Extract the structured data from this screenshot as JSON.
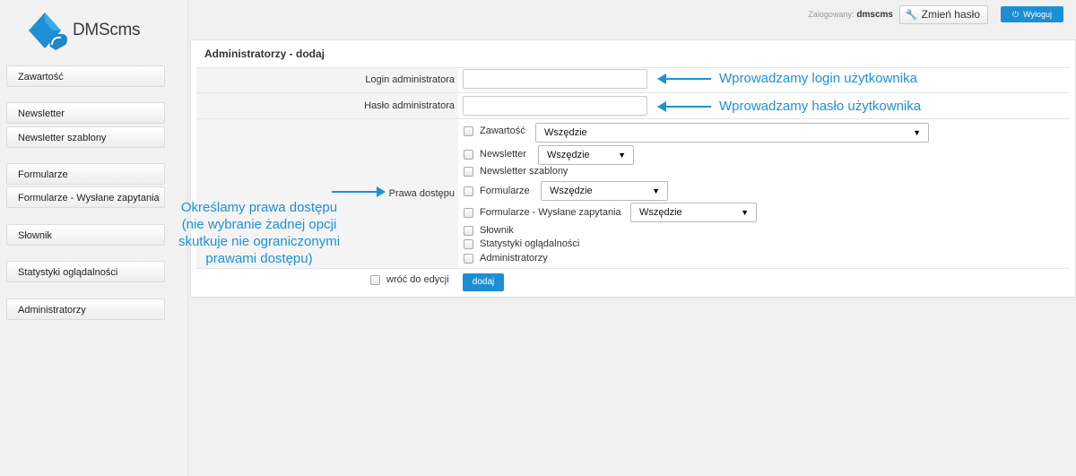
{
  "brand": {
    "name": "DMScms",
    "accent": "#1e8ed3",
    "note_color": "#1e90d6"
  },
  "sidebar": {
    "items": [
      {
        "label": "Zawartość"
      },
      {
        "label": "Newsletter"
      },
      {
        "label": "Newsletter szablony"
      },
      {
        "label": "Formularze"
      },
      {
        "label": "Formularze - Wysłane zapytania"
      },
      {
        "label": "Słownik"
      },
      {
        "label": "Statystyki oglądalności"
      },
      {
        "label": "Administratorzy"
      }
    ]
  },
  "header": {
    "logged_label": "Zalogowany:",
    "username": "dmscms",
    "change_password_label": "Zmień hasło",
    "change_password_icon": "wrench-icon",
    "logout_label": "Wyloguj",
    "logout_icon": "power-icon"
  },
  "form": {
    "title": "Administratorzy - dodaj",
    "login_label": "Login administratora",
    "login_value": "",
    "password_label": "Hasło administratora",
    "password_value": "",
    "rights_label": "Prawa dostępu",
    "permissions": [
      {
        "label": "Zawartość",
        "select": "Wszędzie"
      },
      {
        "label": "Newsletter",
        "select": "Wszędzie"
      },
      {
        "label": "Newsletter szablony"
      },
      {
        "label": "Formularze",
        "select": "Wszędzie"
      },
      {
        "label": "Formularze - Wysłane zapytania",
        "select": "Wszędzie"
      },
      {
        "label": "Słownik"
      },
      {
        "label": "Statystyki oglądalności"
      },
      {
        "label": "Administratorzy"
      }
    ],
    "return_label": "wróć do edycji",
    "submit_label": "dodaj"
  },
  "annotations": {
    "login_note": "Wprowadzamy login użytkownika",
    "password_note": "Wprowadzamy hasło użytkownika",
    "rights_note": [
      "Określamy prawa dostępu",
      "(nie wybranie żadnej opcji",
      "skutkuje nie ograniczonymi",
      "prawami dostępu)"
    ]
  }
}
